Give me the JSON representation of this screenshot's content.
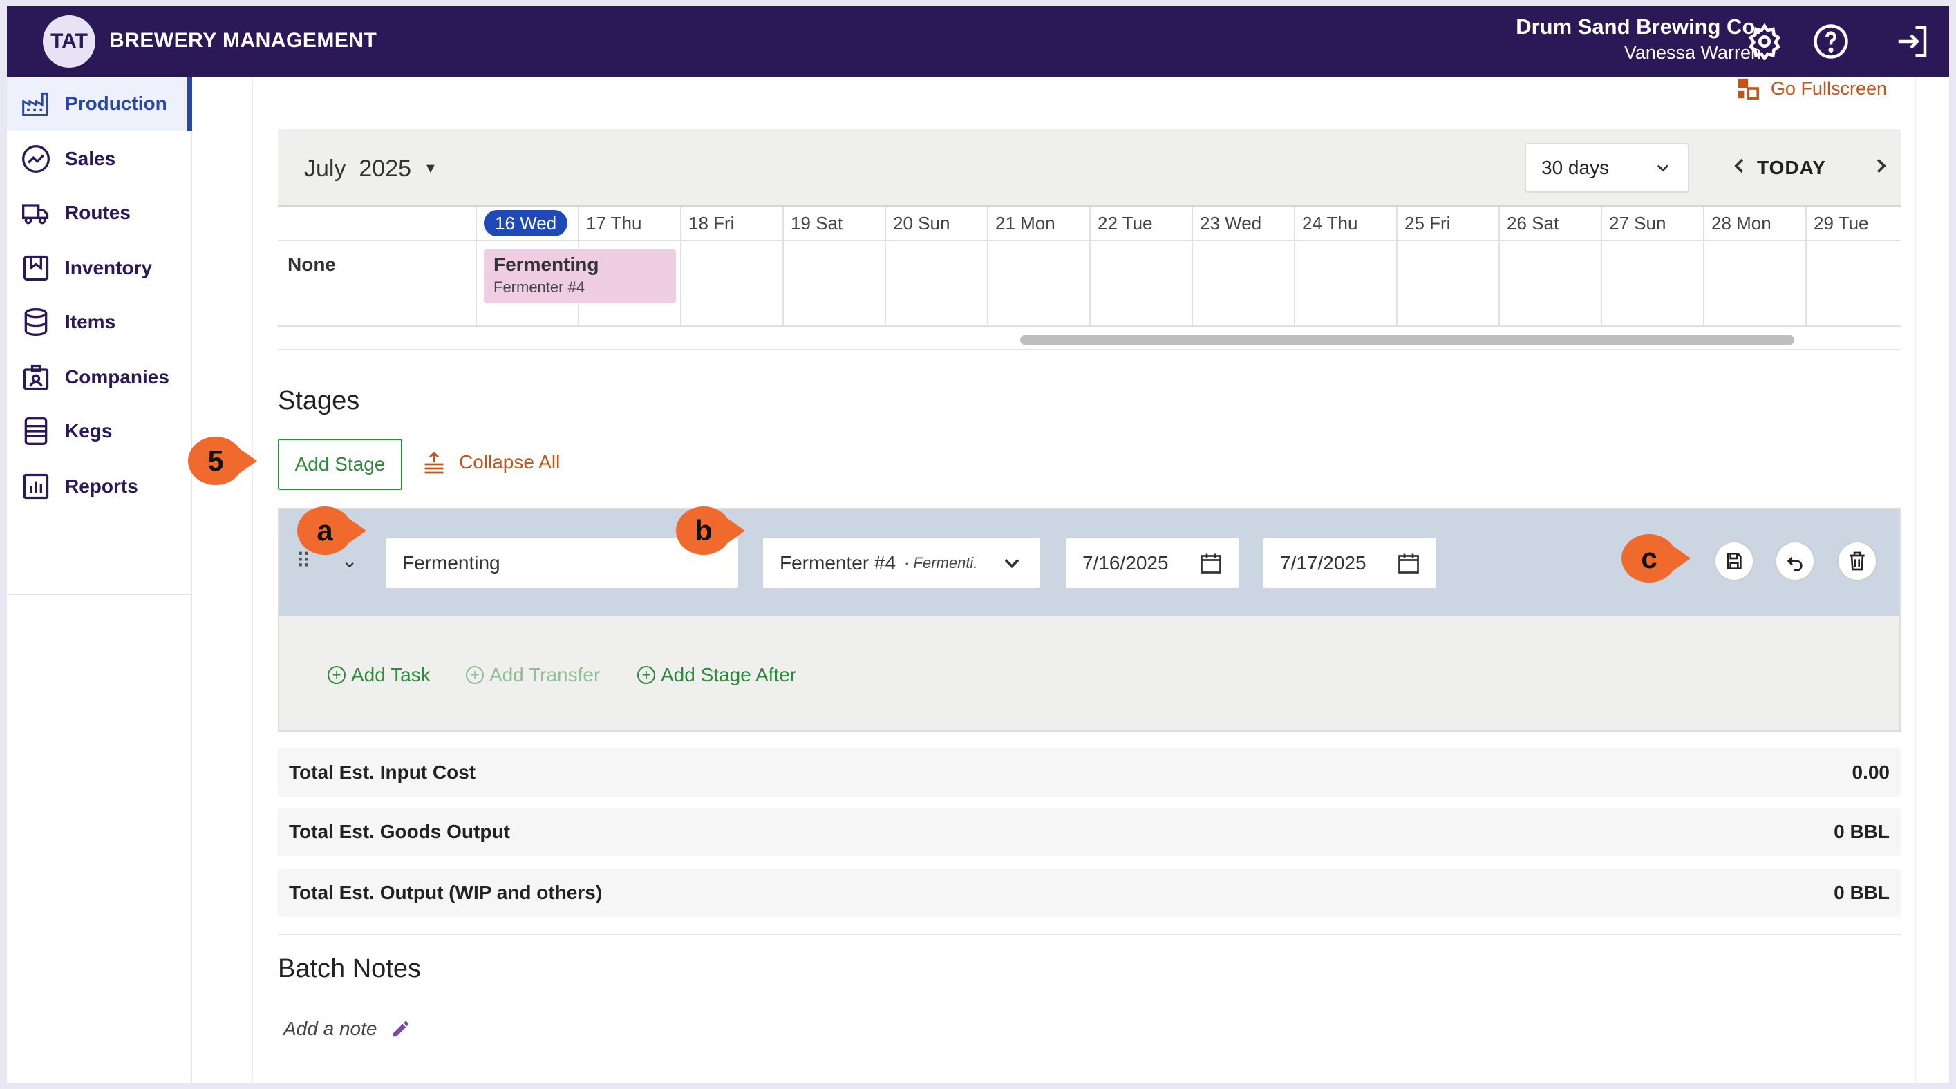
{
  "app": {
    "title": "BREWERY MANAGEMENT",
    "logo": "TAT",
    "company": "Drum Sand Brewing Co.",
    "user": "Vanessa Warren"
  },
  "sidebar": {
    "items": [
      {
        "label": "Production",
        "icon": "factory-icon",
        "active": true
      },
      {
        "label": "Sales",
        "icon": "trend-icon"
      },
      {
        "label": "Routes",
        "icon": "truck-icon"
      },
      {
        "label": "Inventory",
        "icon": "bookmark-icon"
      },
      {
        "label": "Items",
        "icon": "barrel-icon"
      },
      {
        "label": "Companies",
        "icon": "badge-icon"
      },
      {
        "label": "Kegs",
        "icon": "keg-icon"
      },
      {
        "label": "Reports",
        "icon": "chart-icon"
      }
    ]
  },
  "main": {
    "fullscreen_label": "Go Fullscreen",
    "calendar": {
      "month": "July",
      "year": "2025",
      "range": "30 days",
      "today_label": "TODAY",
      "days": [
        "16 Wed",
        "17 Thu",
        "18 Fri",
        "19 Sat",
        "20 Sun",
        "21 Mon",
        "22 Tue",
        "23 Wed",
        "24 Thu",
        "25 Fri",
        "26 Sat",
        "27 Sun",
        "28 Mon",
        "29 Tue"
      ],
      "resource": "None",
      "event": {
        "title": "Fermenting",
        "subtitle": "Fermenter #4"
      }
    },
    "stages": {
      "title": "Stages",
      "add_stage": "Add Stage",
      "collapse_all": "Collapse All",
      "stage": {
        "name": "Fermenting",
        "vessel": "Fermenter #4",
        "vessel_sub": "· Fermenti.",
        "start_date": "7/16/2025",
        "end_date": "7/17/2025"
      },
      "add_task": "Add Task",
      "add_transfer": "Add Transfer",
      "add_stage_after": "Add Stage After"
    },
    "totals": [
      {
        "label": "Total Est. Input Cost",
        "value": "0.00"
      },
      {
        "label": "Total Est. Goods Output",
        "value": "0 BBL"
      },
      {
        "label": "Total Est. Output (WIP and others)",
        "value": "0 BBL"
      }
    ],
    "notes": {
      "title": "Batch Notes",
      "add_note": "Add a note"
    }
  },
  "callouts": [
    "5",
    "a",
    "b",
    "c"
  ],
  "colors": {
    "topbar": "#2b1857",
    "accent_blue": "#2947a8",
    "green": "#2e8a3a",
    "orange": "#c0561b",
    "callout": "#ef6a2c",
    "event": "#efcde3"
  }
}
